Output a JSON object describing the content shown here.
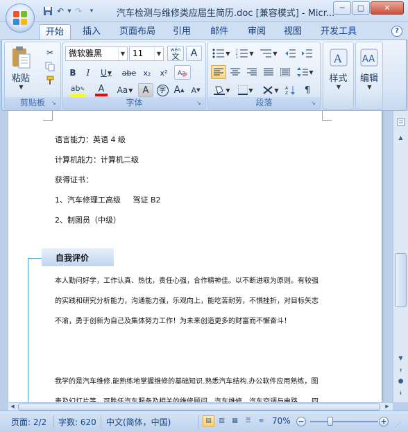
{
  "window": {
    "title": "汽车检测与维修类应届生简历.doc [兼容模式] - Micr...",
    "minimize": "─",
    "maximize": "□",
    "close": "✕"
  },
  "tabs": [
    "开始",
    "插入",
    "页面布局",
    "引用",
    "邮件",
    "审阅",
    "视图",
    "开发工具"
  ],
  "help": "?",
  "ribbon": {
    "clipboard": {
      "label": "剪贴板",
      "paste": "粘贴"
    },
    "font": {
      "label": "字体",
      "font_name": "微软雅黑",
      "font_size": "11",
      "wen": "wén",
      "wen_char": "文",
      "A_box": "A",
      "bold": "B",
      "italic": "I",
      "underline": "U",
      "strike": "abe",
      "subscript": "x₂",
      "superscript": "x²",
      "change_case": "Aa",
      "char_shading": "A",
      "enclose": "字",
      "grow": "A",
      "shrink": "A"
    },
    "paragraph": {
      "label": "段落"
    },
    "styles": {
      "label": "样式"
    },
    "edit": {
      "label": "编辑"
    }
  },
  "document": {
    "lines_top": [
      "语言能力：英语 4 级",
      "计算机能力：计算机二级",
      "获得证书：",
      "1、汽车修理工高级     驾证 B2",
      "2、制图员（中级）"
    ],
    "section_title": "自我评价",
    "lines_section": [
      "本人勤问好学，工作认真、热忱，责任心强，合作精神佳。以不断进取为原则。有较强",
      "的实践和研究分析能力，沟通能力强，乐观向上，能吃苦耐劳，不惧挫折，对目标矢志",
      "不渝，勇于创新为自己及集体努力工作！为未来创造更多的财富而不懈奋斗！"
    ],
    "lines_bottom": [
      "我学的是汽车维修.能熟练地掌握维修的基础知识.熟悉汽车结构.办公软件应用熟练，图",
      "表及幻灯片等，可胜任汽车服务及相关的维修顾问、汽车维修、汽车空调与电路……四"
    ]
  },
  "status": {
    "page": "页面: 2/2",
    "words": "字数: 620",
    "language": "中文(简体，中国)",
    "zoom": "70%",
    "zoom_minus": "−",
    "zoom_plus": "+"
  },
  "colors": {
    "highlight": "#ffff00",
    "font_color": "#ff0000",
    "accent": "#4b9bd4"
  }
}
